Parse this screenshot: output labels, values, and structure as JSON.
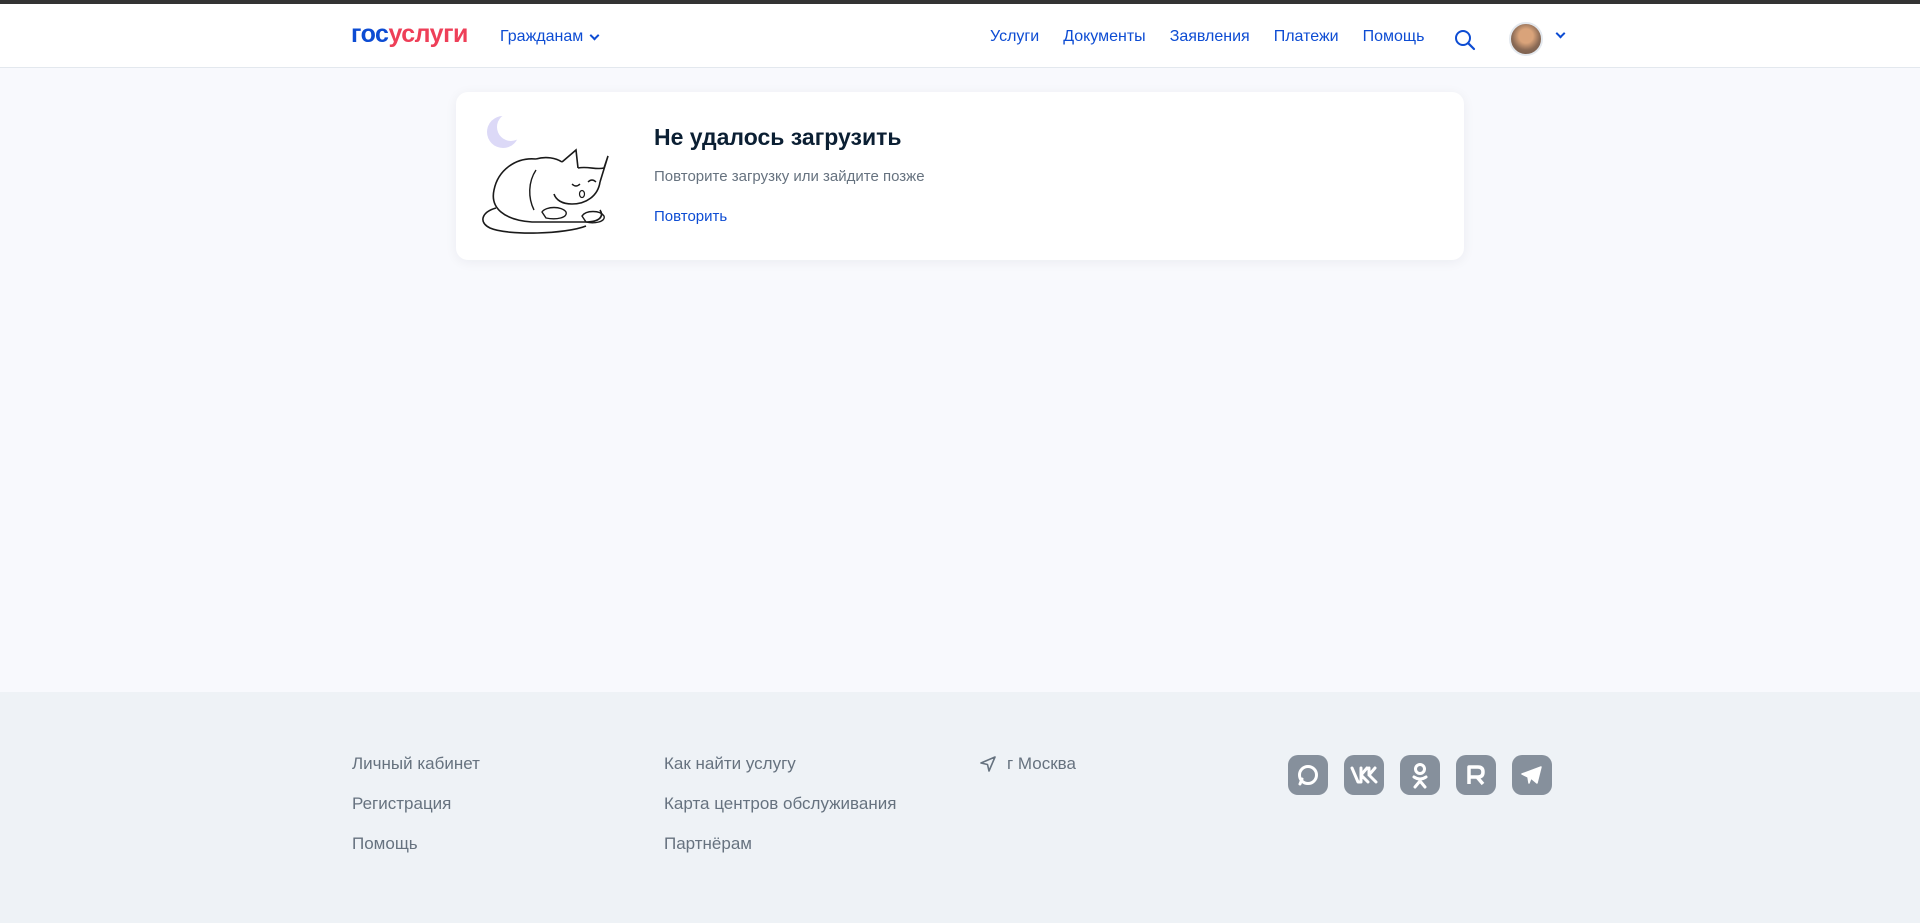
{
  "header": {
    "logo_gos": "гос",
    "logo_uslugi": "услуги",
    "role_label": "Гражданам",
    "nav": [
      "Услуги",
      "Документы",
      "Заявления",
      "Платежи",
      "Помощь"
    ]
  },
  "error_card": {
    "title": "Не удалось загрузить",
    "subtitle": "Повторите загрузку или зайдите позже",
    "retry_label": "Повторить"
  },
  "footer": {
    "col1": [
      "Личный кабинет",
      "Регистрация",
      "Помощь"
    ],
    "col2": [
      "Как найти услугу",
      "Карта центров обслуживания",
      "Партнёрам"
    ],
    "city": "г Москва",
    "socials": [
      "max-icon",
      "vk-icon",
      "ok-icon",
      "rutube-icon",
      "telegram-icon"
    ]
  },
  "colors": {
    "brand_blue": "#0d4cd3",
    "brand_red": "#ee3f58",
    "page_bg": "#f8f9fd",
    "footer_bg": "#eef2f6",
    "social_bg": "#86909c"
  }
}
